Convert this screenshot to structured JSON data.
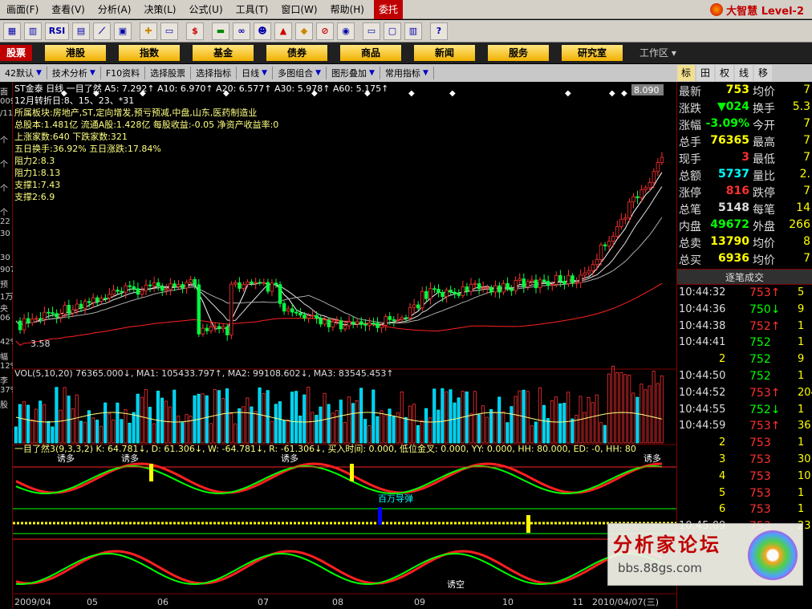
{
  "menus": [
    "画面(F)",
    "查看(V)",
    "分析(A)",
    "决策(L)",
    "公式(U)",
    "工具(T)",
    "窗口(W)",
    "帮助(H)",
    "委托"
  ],
  "brand": "大智慧 Level-2",
  "toolbar_labels": [
    "RSI",
    "$"
  ],
  "nav": [
    "股票",
    "港股",
    "指数",
    "基金",
    "债券",
    "商品",
    "新闻",
    "服务",
    "研究室"
  ],
  "workarea": "工作区",
  "subbar": [
    "42默认",
    "技术分析",
    "F10资料",
    "选择股票",
    "选择指标",
    "日线",
    "多图组合",
    "图形叠加",
    "常用指标"
  ],
  "right_tabs": [
    "标",
    "田",
    "权",
    "线",
    "移"
  ],
  "left_strip": [
    "面",
    "009",
    "/11",
    "",
    "个",
    "",
    "个",
    "",
    "个",
    "",
    "个",
    "22",
    "30",
    "",
    "30",
    "907",
    "预",
    "1万",
    "央",
    "06",
    "",
    "42%",
    "幅",
    "12%",
    "李",
    "37%",
    "股"
  ],
  "chart": {
    "title_line": "ST金泰 日线  一目了然 A5: 7.292↑ A10: 6.970↑ A20: 6.577↑ A30: 5.978↑ A60: 5.175↑",
    "price_tag": "8.090",
    "info_lines": [
      "12月转折日:8、15、23、*31",
      "所属板块:房地产,ST,定向增发,预亏预减,中盘,山东,医药制造业",
      "总股本:1.481亿 流通A股:1.428亿 每股收益:-0.05 净资产收益率:0",
      "上涨家数:640      下跌家数:321",
      "五日换手:36.92%    五日涨跌:17.84%",
      "阻力2:8.3",
      "阻力1:8.13",
      "支撑1:7.43",
      "支撑2:6.9"
    ],
    "low_label": "3.58",
    "vol_line": "VOL(5,10,20)  76365.000↓, MA1: 105433.797↑, MA2: 99108.602↓, MA3: 83545.453↑",
    "ind_line": "一目了然3(9,3,3,2) K: 64.781↓, D: 61.306↓, W: -64.781↓, R: -61.306↓, 买入时间: 0.000, 低位金叉: 0.000, YY: 0.000, HH: 80.000, ED: -0, HH: 80",
    "annotations": [
      "诱多",
      "诱多",
      "诱多",
      "诱多",
      "百万导弹",
      "诱空"
    ],
    "axis_dates": [
      "2009/04",
      "05",
      "06",
      "07",
      "08",
      "09",
      "10",
      "11",
      "2010/04/07(三)"
    ],
    "left_axis": [
      "9",
      "5"
    ]
  },
  "quotes": [
    {
      "l": "最新",
      "v": "753",
      "c": "#ffff00",
      "l2": "均价",
      "v2": "7"
    },
    {
      "l": "涨跌",
      "v": "▼024",
      "c": "#00ff00",
      "l2": "换手",
      "v2": "5.3"
    },
    {
      "l": "涨幅",
      "v": "-3.09%",
      "c": "#00ff00",
      "l2": "今开",
      "v2": "7"
    },
    {
      "l": "总手",
      "v": "76365",
      "c": "#ffff00",
      "l2": "最高",
      "v2": "7"
    },
    {
      "l": "现手",
      "v": "3",
      "c": "#ff3030",
      "l2": "最低",
      "v2": "7"
    },
    {
      "l": "总额",
      "v": "5737",
      "c": "#00ffff",
      "l2": "量比",
      "v2": "2."
    },
    {
      "l": "涨停",
      "v": "816",
      "c": "#ff3030",
      "l2": "跌停",
      "v2": "7"
    },
    {
      "l": "总笔",
      "v": "5148",
      "c": "#dddddd",
      "l2": "每笔",
      "v2": "14"
    },
    {
      "l": "内盘",
      "v": "49672",
      "c": "#00ff00",
      "l2": "外盘",
      "v2": "266"
    },
    {
      "l": "总卖",
      "v": "13790",
      "c": "#ffff00",
      "l2": "均价",
      "v2": "8"
    },
    {
      "l": "总买",
      "v": "6936",
      "c": "#ffff00",
      "l2": "均价",
      "v2": "7"
    }
  ],
  "trades_header": "逐笔成交",
  "trades": [
    {
      "t": "10:44:32",
      "p": "753↑",
      "c": "#ff3030",
      "v": "5"
    },
    {
      "t": "10:44:36",
      "p": "750↓",
      "c": "#00ff00",
      "v": "9"
    },
    {
      "t": "10:44:38",
      "p": "752↑",
      "c": "#ff3030",
      "v": "1"
    },
    {
      "t": "10:44:41",
      "p": "752",
      "c": "#00ff00",
      "v": "1"
    },
    {
      "t": "2",
      "p": "752",
      "c": "#00ff00",
      "v": "9"
    },
    {
      "t": "10:44:50",
      "p": "752",
      "c": "#00ff00",
      "v": "1"
    },
    {
      "t": "10:44:52",
      "p": "753↑",
      "c": "#ff3030",
      "v": "204"
    },
    {
      "t": "10:44:55",
      "p": "752↓",
      "c": "#00ff00",
      "v": "1"
    },
    {
      "t": "10:44:59",
      "p": "753↑",
      "c": "#ff3030",
      "v": "36"
    },
    {
      "t": "2",
      "p": "753",
      "c": "#ff3030",
      "v": "1"
    },
    {
      "t": "3",
      "p": "753",
      "c": "#ff3030",
      "v": "30"
    },
    {
      "t": "4",
      "p": "753",
      "c": "#ff3030",
      "v": "10"
    },
    {
      "t": "5",
      "p": "753",
      "c": "#ff3030",
      "v": "1"
    },
    {
      "t": "6",
      "p": "753",
      "c": "#ff3030",
      "v": "1"
    },
    {
      "t": "10:45:09",
      "p": "753",
      "c": "#ff3030",
      "v": "23"
    }
  ],
  "watermark": {
    "title": "分析家论坛",
    "url": "bbs.88gs.com"
  }
}
